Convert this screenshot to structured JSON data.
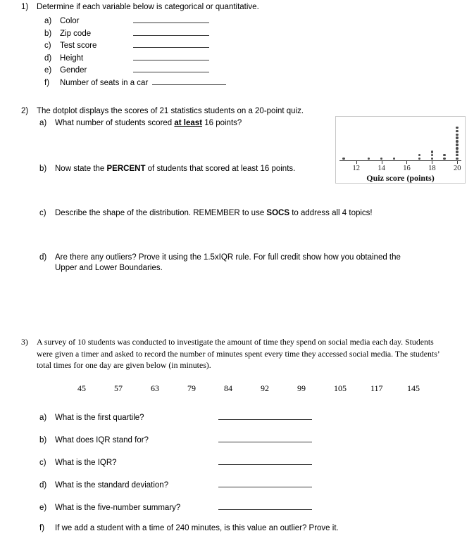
{
  "questions": [
    {
      "number": "1)",
      "stem": "Determine if each variable below is categorical or quantitative.",
      "items": [
        {
          "letter": "a)",
          "text": "Color"
        },
        {
          "letter": "b)",
          "text": "Zip code"
        },
        {
          "letter": "c)",
          "text": "Test score"
        },
        {
          "letter": "d)",
          "text": "Height"
        },
        {
          "letter": "e)",
          "text": "Gender"
        },
        {
          "letter": "f)",
          "text": "Number of seats in a car"
        }
      ]
    },
    {
      "number": "2)",
      "stem": "The dotplot displays the scores of 21 statistics students on a 20-point quiz.",
      "items": [
        {
          "letter": "a)",
          "text_1": "What number of students scored ",
          "emphasis": "at least",
          "text_2": " 16 points?"
        },
        {
          "letter": "b)",
          "text_1": "Now state the ",
          "emphasis": "PERCENT",
          "text_2": " of students that scored at least 16 points."
        },
        {
          "letter": "c)",
          "text_1": "Describe the shape of the distribution. REMEMBER to use ",
          "emphasis": "SOCS",
          "text_2": " to address all 4 topics!"
        },
        {
          "letter": "d)",
          "text_1": "Are there any outliers? Prove it using the 1.5xIQR rule. For full credit show how you obtained the Upper and Lower Boundaries.",
          "emphasis": "",
          "text_2": ""
        }
      ]
    },
    {
      "number": "3)",
      "stem": "A survey of 10 students was conducted to investigate the amount of time they spend on social media each day. Students were given a timer and asked to record the number of minutes spent every time they accessed social media. The students’ total times for one day are given below (in minutes).",
      "data_values": [
        "45",
        "57",
        "63",
        "79",
        "84",
        "92",
        "99",
        "105",
        "117",
        "145"
      ],
      "items": [
        {
          "letter": "a)",
          "text": "What is the first quartile?",
          "has_blank": true
        },
        {
          "letter": "b)",
          "text": "What does IQR stand for?",
          "has_blank": true
        },
        {
          "letter": "c)",
          "text": "What is the IQR?",
          "has_blank": true
        },
        {
          "letter": "d)",
          "text": "What is the standard deviation?",
          "has_blank": true
        },
        {
          "letter": "e)",
          "text": "What is the five-number summary?",
          "has_blank": true
        },
        {
          "letter": "f)",
          "text": "If we add a student with a time of 240 minutes, is this value an outlier? Prove it.",
          "has_blank": false
        }
      ]
    }
  ],
  "chart_data": {
    "type": "scatter",
    "subtype": "dotplot",
    "title": "",
    "xlabel": "Quiz score (points)",
    "ylabel": "",
    "xlim": [
      10.4,
      20.6
    ],
    "tick_labels": [
      "12",
      "14",
      "16",
      "18",
      "20"
    ],
    "tick_values": [
      12,
      14,
      16,
      18,
      20
    ],
    "grid": false,
    "legend": "none",
    "total_count": 21,
    "x": [
      11,
      13,
      14,
      15,
      17,
      18,
      19,
      20
    ],
    "counts": [
      1,
      1,
      1,
      1,
      2,
      3,
      2,
      10
    ],
    "dot_color": "#4a4a4a",
    "axis_color": "#333333",
    "border_color": "#c8c8c8"
  }
}
